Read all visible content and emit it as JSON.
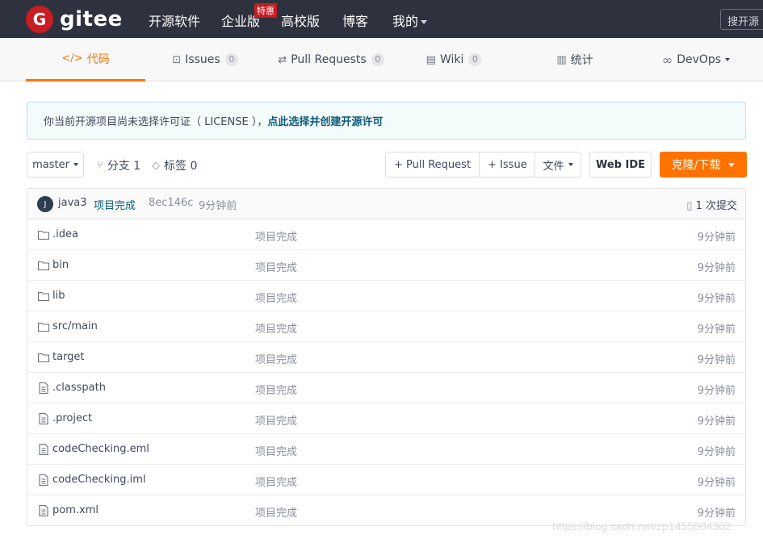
{
  "topnav": {
    "logo_letter": "G",
    "logo_text": "gitee",
    "items": [
      "开源软件",
      "企业版",
      "高校版",
      "博客",
      "我的"
    ],
    "hot_badge": "特惠",
    "search_placeholder": "搜开源"
  },
  "tabs": [
    {
      "icon": "code-icon",
      "glyph": "</>",
      "label": "代码",
      "count": ""
    },
    {
      "icon": "issues-icon",
      "glyph": "⊡",
      "label": "Issues",
      "count": "0"
    },
    {
      "icon": "pull-request-icon",
      "glyph": "⇄",
      "label": "Pull Requests",
      "count": "0"
    },
    {
      "icon": "wiki-icon",
      "glyph": "▤",
      "label": "Wiki",
      "count": "0"
    },
    {
      "icon": "stats-icon",
      "glyph": "▥",
      "label": "统计",
      "count": ""
    },
    {
      "icon": "devops-icon",
      "glyph": "∞",
      "label": "DevOps",
      "count": ""
    }
  ],
  "notice": {
    "text": "你当前开源项目尚未选择许可证（ LICENSE ），",
    "link": "点此选择并创建开源许可"
  },
  "toolbar": {
    "branch": "master",
    "branches_label": "分支 1",
    "tags_label": "标签 0",
    "pull_request_btn": "+ Pull Request",
    "issue_btn": "+ Issue",
    "file_btn": "文件",
    "webide_btn": "Web IDE",
    "clone_btn": "克隆/下载"
  },
  "commit": {
    "avatar_letter": "J",
    "author": "java3",
    "message": "项目完成",
    "hash": "8ec146c",
    "time": "9分钟前",
    "commits_label": "1 次提交"
  },
  "files": [
    {
      "type": "folder",
      "name": ".idea",
      "message": "项目完成",
      "time": "9分钟前"
    },
    {
      "type": "folder",
      "name": "bin",
      "message": "项目完成",
      "time": "9分钟前"
    },
    {
      "type": "folder",
      "name": "lib",
      "message": "项目完成",
      "time": "9分钟前"
    },
    {
      "type": "folder",
      "name": "src/main",
      "message": "项目完成",
      "time": "9分钟前"
    },
    {
      "type": "folder",
      "name": "target",
      "message": "项目完成",
      "time": "9分钟前"
    },
    {
      "type": "file",
      "name": ".classpath",
      "message": "项目完成",
      "time": "9分钟前"
    },
    {
      "type": "file",
      "name": ".project",
      "message": "项目完成",
      "time": "9分钟前"
    },
    {
      "type": "file",
      "name": "codeChecking.eml",
      "message": "项目完成",
      "time": "9分钟前"
    },
    {
      "type": "file",
      "name": "codeChecking.iml",
      "message": "项目完成",
      "time": "9分钟前"
    },
    {
      "type": "file",
      "name": "pom.xml",
      "message": "项目完成",
      "time": "9分钟前"
    }
  ],
  "watermark": "https://blog.csdn.net/zp1455004302",
  "colors": {
    "accent": "#fe7300",
    "nav_bg": "#2d323e",
    "brand_red": "#c71d23"
  }
}
